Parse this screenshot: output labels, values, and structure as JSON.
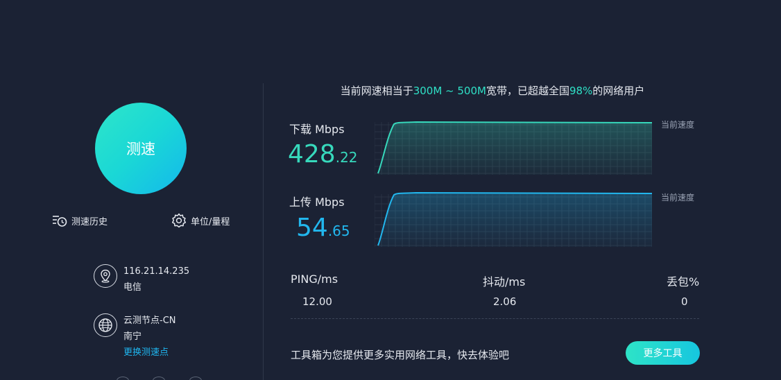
{
  "start": {
    "label": "测速"
  },
  "tools": {
    "history_label": "测速历史",
    "units_label": "单位/量程"
  },
  "connection": {
    "ip": "116.21.14.235",
    "isp": "电信",
    "node_name": "云测节点-CN",
    "node_city": "南宁",
    "change_label": "更换测速点"
  },
  "summary": {
    "prefix": "当前网速相当于",
    "bandwidth": "300M ~ 500M",
    "middle": "宽带，已超越全国",
    "percent": "98%",
    "suffix": "的网络用户"
  },
  "download": {
    "label": "下载 Mbps",
    "value_int": "428",
    "value_dec": ".22",
    "current_label": "当前速度",
    "color": "#37d9bc"
  },
  "upload": {
    "label": "上传 Mbps",
    "value_int": "54",
    "value_dec": ".65",
    "current_label": "当前速度",
    "color": "#22b7ee"
  },
  "stats": {
    "ping_label": "PING/ms",
    "ping_value": "12.00",
    "jitter_label": "抖动/ms",
    "jitter_value": "2.06",
    "loss_label": "丢包%",
    "loss_value": "0"
  },
  "promo": {
    "text": "工具箱为您提供更多实用网络工具，快去体验吧",
    "button_label": "更多工具"
  },
  "icons": {
    "history": "history-clock-icon",
    "units": "gear-icon",
    "ip": "location-pin-icon",
    "node": "globe-icon"
  }
}
